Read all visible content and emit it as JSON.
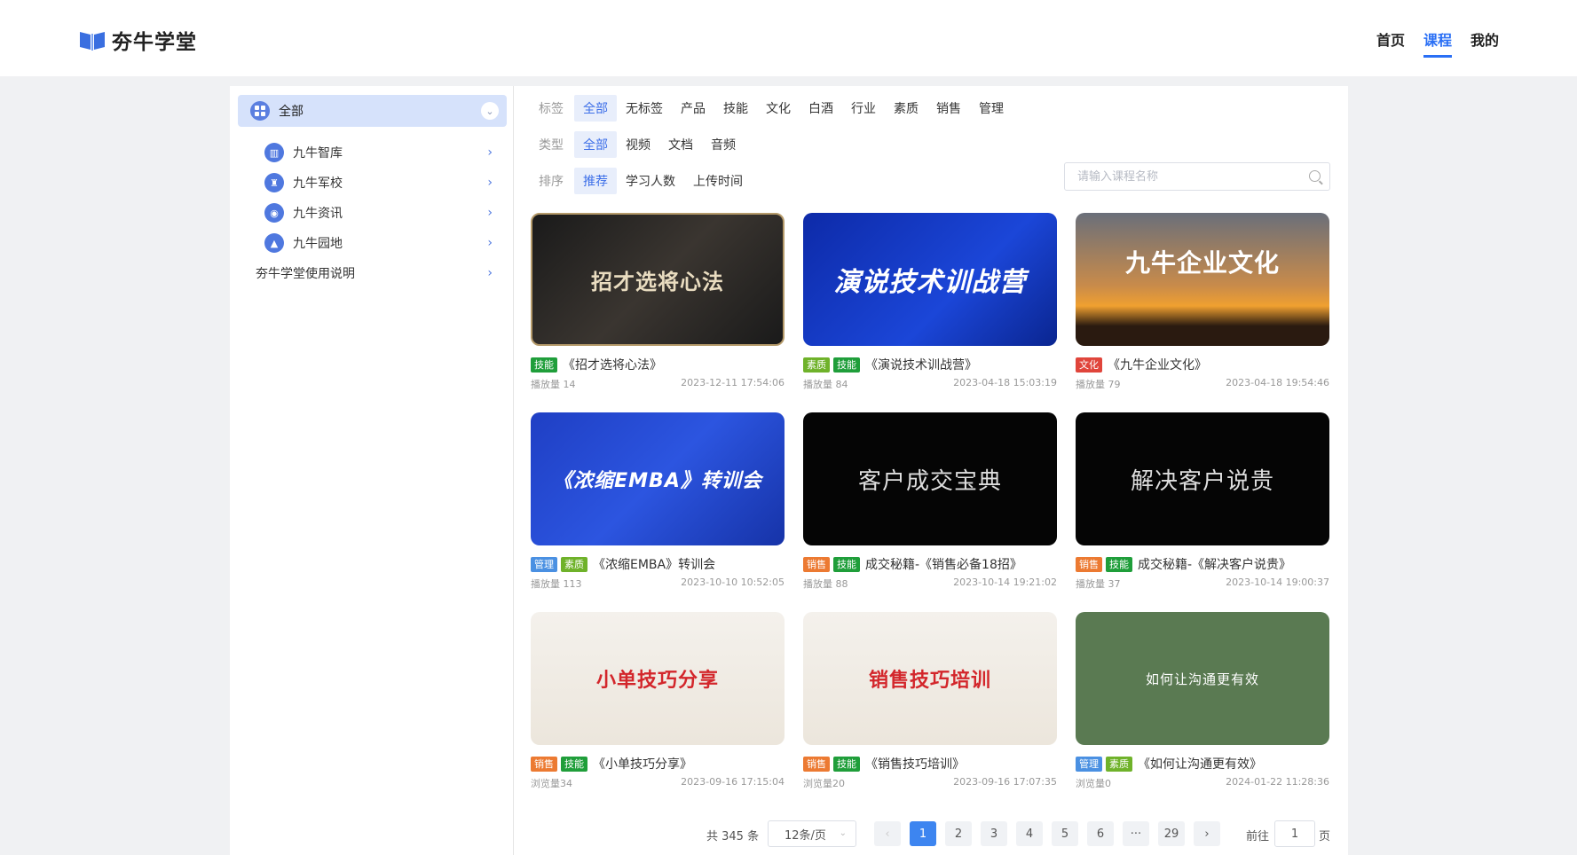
{
  "header": {
    "logo_text": "夯牛学堂",
    "nav": [
      "首页",
      "课程",
      "我的"
    ],
    "active_nav": "课程"
  },
  "sidebar": {
    "all_label": "全部",
    "items": [
      {
        "label": "九牛智库",
        "icon": "library-icon"
      },
      {
        "label": "九牛军校",
        "icon": "shield-icon"
      },
      {
        "label": "九牛资讯",
        "icon": "news-icon"
      },
      {
        "label": "九牛园地",
        "icon": "graduation-icon"
      }
    ],
    "plain_item": "夯牛学堂使用说明"
  },
  "filters": {
    "tags": {
      "label": "标签",
      "options": [
        "全部",
        "无标签",
        "产品",
        "技能",
        "文化",
        "白酒",
        "行业",
        "素质",
        "销售",
        "管理"
      ],
      "selected": "全部"
    },
    "types": {
      "label": "类型",
      "options": [
        "全部",
        "视频",
        "文档",
        "音频"
      ],
      "selected": "全部"
    },
    "sort": {
      "label": "排序",
      "options": [
        "推荐",
        "学习人数",
        "上传时间"
      ],
      "selected": "推荐"
    }
  },
  "search": {
    "placeholder": "请输入课程名称",
    "value": ""
  },
  "courses": [
    {
      "thumb_text": "招才选将心法",
      "tags": [
        "技能"
      ],
      "title": "《招才选将心法》",
      "count": "播放量 14",
      "date": "2023-12-11 17:54:06"
    },
    {
      "thumb_text": "演说技术训战营",
      "tags": [
        "素质",
        "技能"
      ],
      "title": "《演说技术训战营》",
      "count": "播放量 84",
      "date": "2023-04-18 15:03:19"
    },
    {
      "thumb_text": "九牛企业文化",
      "tags": [
        "文化"
      ],
      "title": "《九牛企业文化》",
      "count": "播放量 79",
      "date": "2023-04-18 19:54:46"
    },
    {
      "thumb_text": "《浓缩EMBA》转训会",
      "tags": [
        "管理",
        "素质"
      ],
      "title": "《浓缩EMBA》转训会",
      "count": "播放量 113",
      "date": "2023-10-10 10:52:05"
    },
    {
      "thumb_text": "客户成交宝典",
      "tags": [
        "销售",
        "技能"
      ],
      "title": "成交秘籍-《销售必备18招》",
      "count": "播放量 88",
      "date": "2023-10-14 19:21:02"
    },
    {
      "thumb_text": "解决客户说贵",
      "tags": [
        "销售",
        "技能"
      ],
      "title": "成交秘籍-《解决客户说贵》",
      "count": "播放量 37",
      "date": "2023-10-14 19:00:37"
    },
    {
      "thumb_text": "小单技巧分享",
      "tags": [
        "销售",
        "技能"
      ],
      "title": "《小单技巧分享》",
      "count": "浏览量34",
      "date": "2023-09-16 17:15:04"
    },
    {
      "thumb_text": "销售技巧培训",
      "tags": [
        "销售",
        "技能"
      ],
      "title": "《销售技巧培训》",
      "count": "浏览量20",
      "date": "2023-09-16 17:07:35"
    },
    {
      "thumb_text": "如何让沟通更有效",
      "tags": [
        "管理",
        "素质"
      ],
      "title": "《如何让沟通更有效》",
      "count": "浏览量0",
      "date": "2024-01-22 11:28:36"
    }
  ],
  "tag_colors": {
    "技能": "#1f9e3a",
    "素质": "#6fb22a",
    "文化": "#e0453b",
    "管理": "#4a90e2",
    "销售": "#ec7a32"
  },
  "pagination": {
    "total": "共 345 条",
    "page_size": "12条/页",
    "pages": [
      "1",
      "2",
      "3",
      "4",
      "5",
      "6",
      "···",
      "29"
    ],
    "current": "1",
    "goto_label": "前往",
    "goto_value": "1",
    "goto_unit": "页"
  }
}
